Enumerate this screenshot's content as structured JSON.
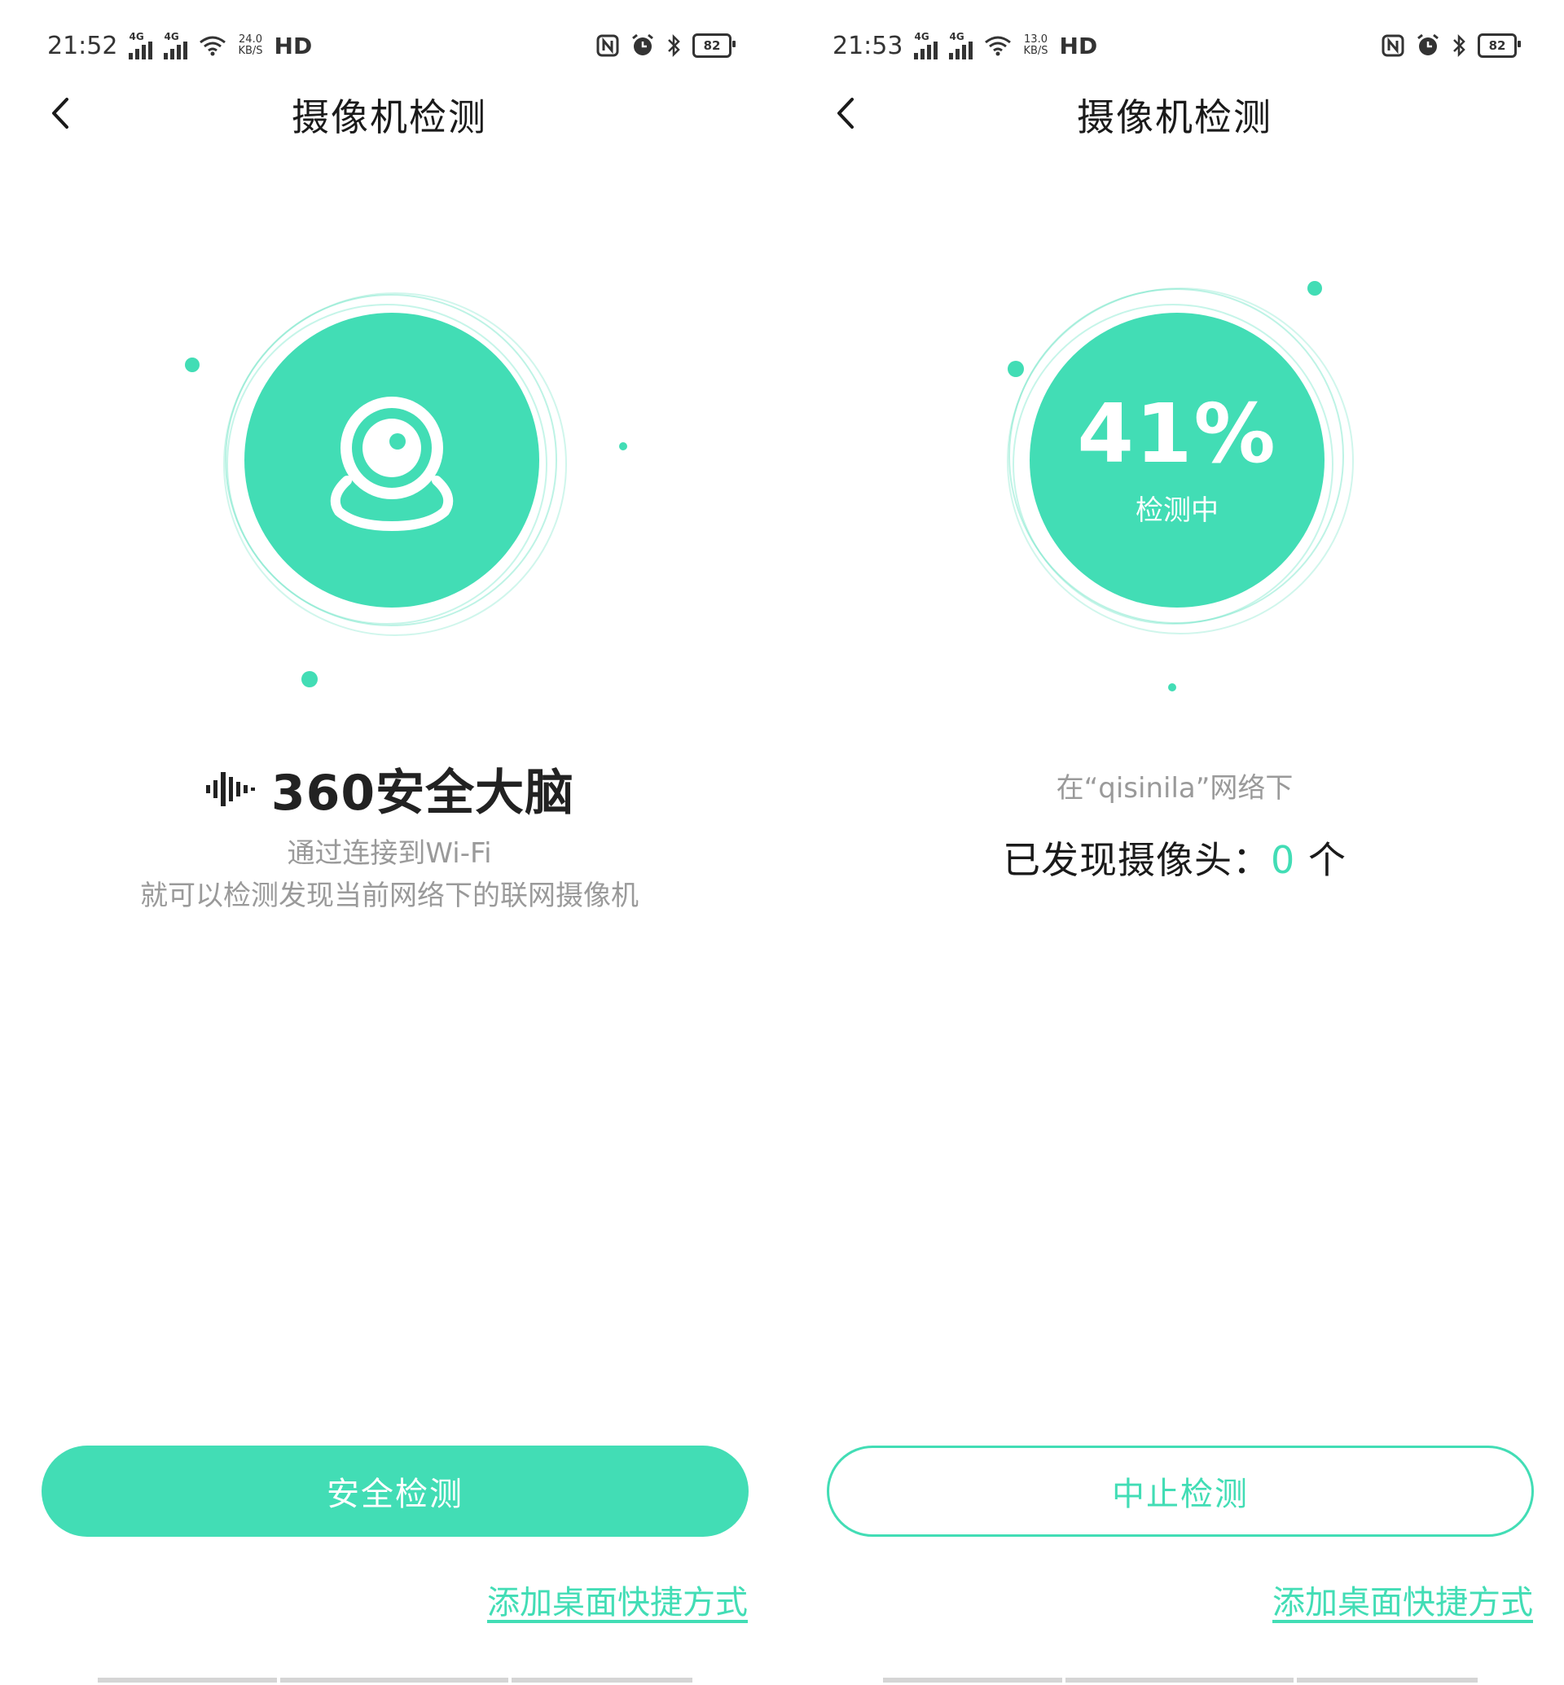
{
  "colors": {
    "accent": "#42ddb5",
    "text": "#1a1a1a",
    "muted": "#9a9a9a"
  },
  "left": {
    "status": {
      "time": "21:52",
      "net1": "4G",
      "net2": "4G",
      "speed_top": "24.0",
      "speed_bottom": "KB/S",
      "hd": "HD",
      "battery": "82"
    },
    "header": {
      "title": "摄像机检测",
      "back_icon": "chevron-left-icon"
    },
    "visual": {
      "icon": "webcam-icon"
    },
    "brand": {
      "text": "360安全大脑",
      "icon": "sound-wave-icon"
    },
    "description": {
      "line1": "通过连接到Wi-Fi",
      "line2": "就可以检测发现当前网络下的联网摄像机"
    },
    "button": {
      "label": "安全检测"
    },
    "shortcut_link": "添加桌面快捷方式"
  },
  "right": {
    "status": {
      "time": "21:53",
      "net1": "4G",
      "net2": "4G",
      "speed_top": "13.0",
      "speed_bottom": "KB/S",
      "hd": "HD",
      "battery": "82"
    },
    "header": {
      "title": "摄像机检测",
      "back_icon": "chevron-left-icon"
    },
    "progress": {
      "percent_label": "41%",
      "value": 0.41,
      "status": "检测中"
    },
    "network_text": "在“qisinila”网络下",
    "found": {
      "label": "已发现摄像头：",
      "count": "0",
      "unit": "个"
    },
    "button": {
      "label": "中止检测"
    },
    "shortcut_link": "添加桌面快捷方式"
  }
}
